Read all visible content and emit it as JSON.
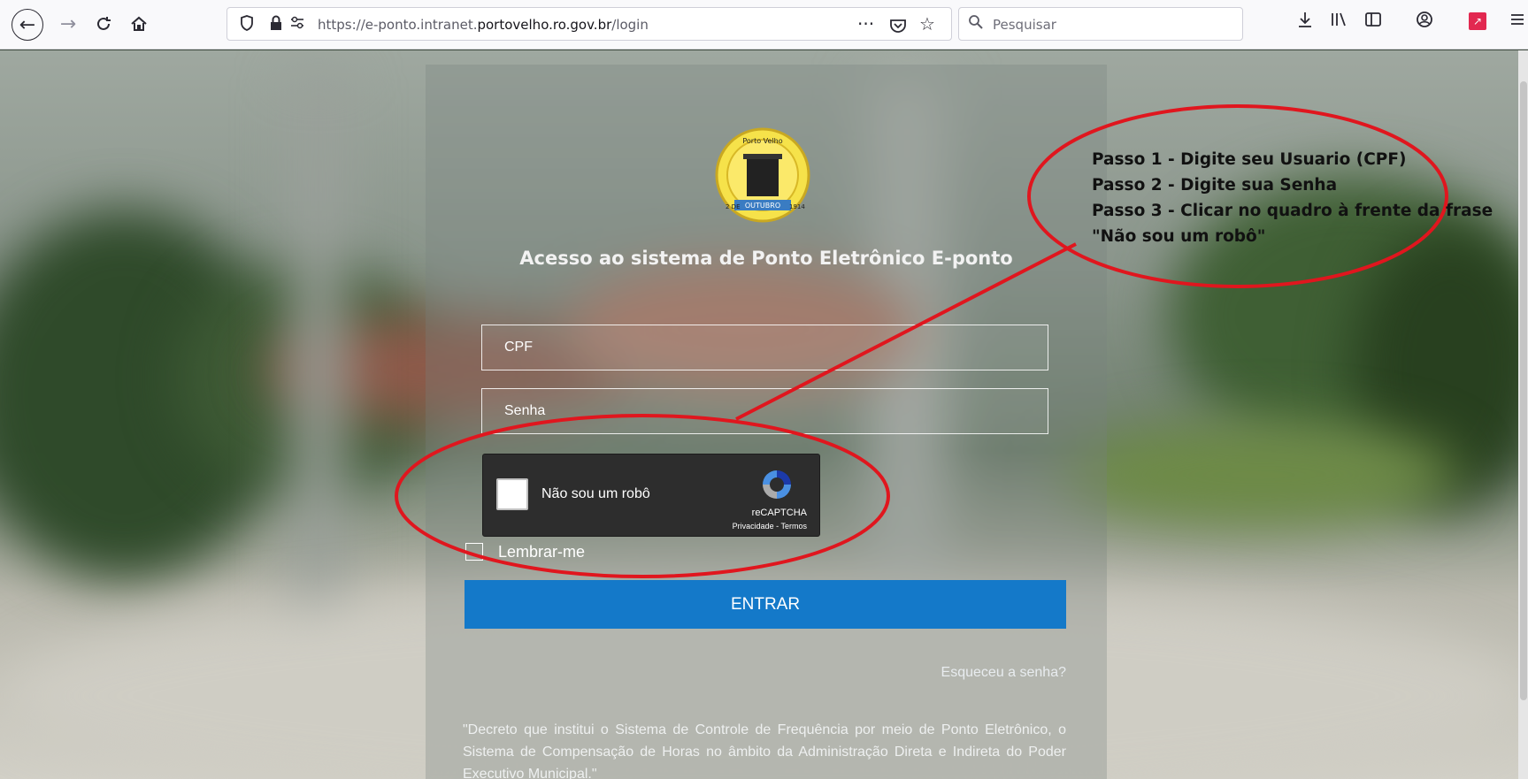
{
  "browser": {
    "url_prefix": "https://e-ponto.intranet.",
    "url_domain": "portovelho.ro.gov.br",
    "url_path": "/login",
    "search_placeholder": "Pesquisar",
    "icons": [
      "back-icon",
      "forward-icon",
      "reload-icon",
      "home-icon",
      "shield-icon",
      "lock-icon",
      "permissions-icon",
      "more-icon",
      "pocket-icon",
      "bookmark-star-icon",
      "search-icon",
      "download-icon",
      "library-icon",
      "sidebar-icon",
      "account-icon",
      "addon-icon",
      "menu-icon"
    ]
  },
  "login": {
    "title": "Acesso ao sistema de Ponto Eletrônico E-ponto",
    "cpf_placeholder": "CPF",
    "password_placeholder": "Senha",
    "recaptcha": {
      "label": "Não sou um robô",
      "brand": "reCAPTCHA",
      "links": "Privacidade - Termos"
    },
    "remember_label": "Lembrar-me",
    "submit_label": "ENTRAR",
    "forgot_label": "Esqueceu a senha?",
    "decree_text": "\"Decreto que institui o Sistema de Controle de Frequência por meio de Ponto Eletrônico, o Sistema de Compensação de Horas no âmbito da Administração Direta e Indireta do Poder Executivo Municipal.\""
  },
  "logo": {
    "top_text": "Porto Velho",
    "ribbon_text": "OUTUBRO",
    "left_text": "2 DE",
    "right_text": "1914"
  },
  "annotation": {
    "steps": [
      "Passo 1 - Digite seu Usuario (CPF)",
      "Passo 2 - Digite sua Senha",
      "Passo 3 - Clicar no quadro à frente da frase",
      "\"Não sou um robô\""
    ],
    "color": "#e0161e"
  },
  "colors": {
    "primary_button": "#1479c9",
    "recaptcha_bg": "#2d2d2d"
  }
}
